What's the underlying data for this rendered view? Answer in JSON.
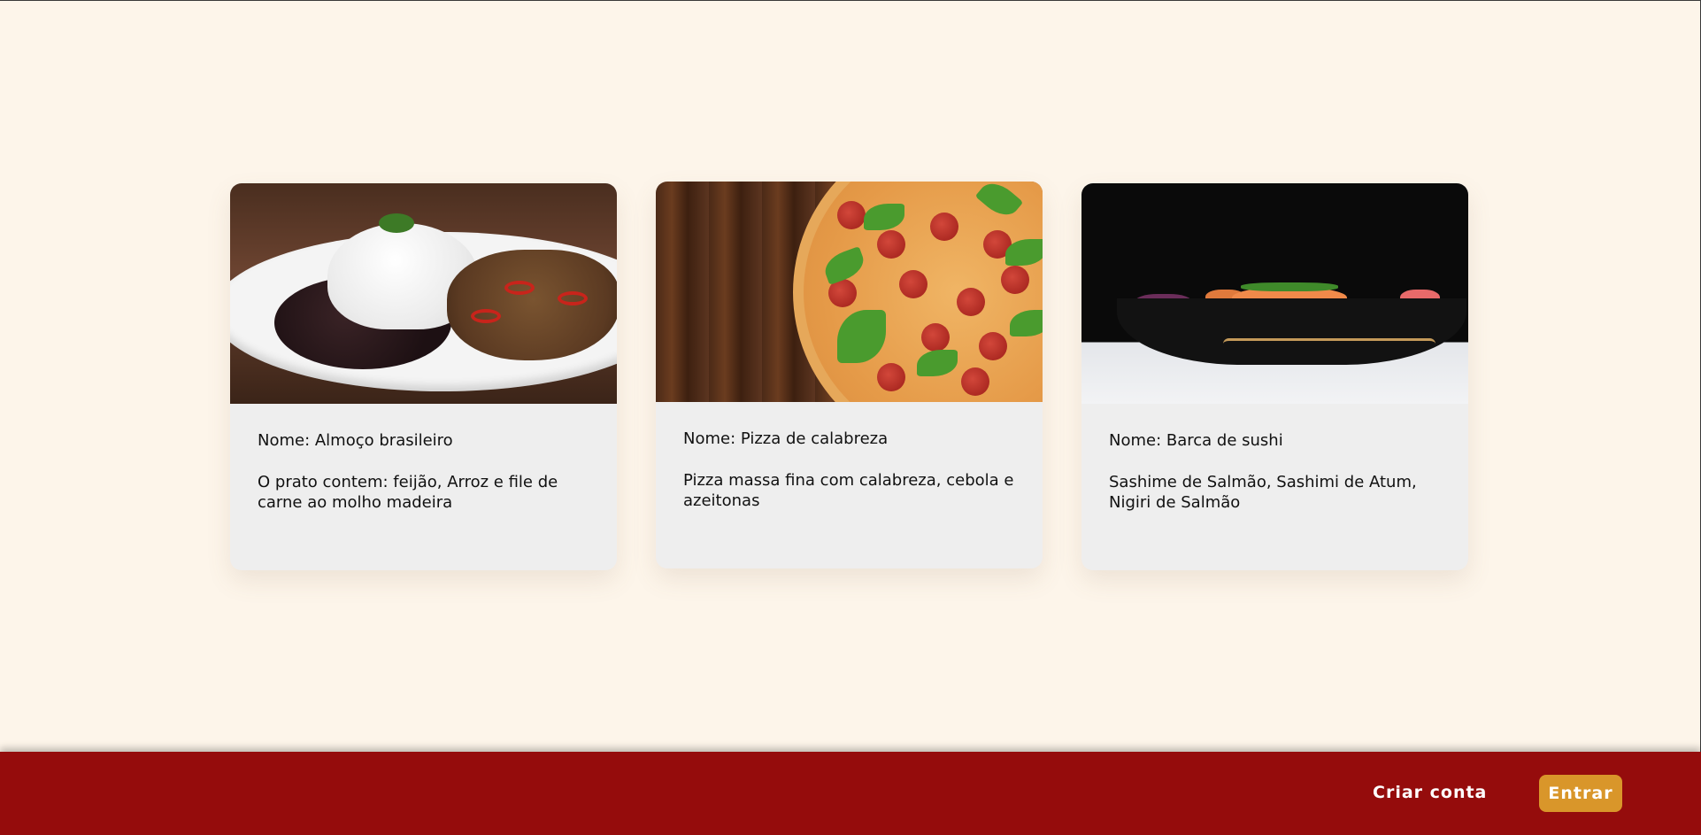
{
  "cards": [
    {
      "image": "brazilian-lunch-plate",
      "name": "Nome: Almoço brasileiro",
      "description": "O prato contem: feijão, Arroz e file de carne ao molho madeira"
    },
    {
      "image": "pepperoni-pizza",
      "name": "Nome: Pizza de calabreza",
      "description": "Pizza massa fina com calabreza, cebola e azeitonas"
    },
    {
      "image": "sushi-boat",
      "name": "Nome: Barca de sushi",
      "description": "Sashime de Salmão, Sashimi de Atum, Nigiri de Salmão"
    }
  ],
  "footer": {
    "create_account_label": "Criar conta",
    "login_label": "Entrar"
  },
  "colors": {
    "background": "#fdf5ea",
    "card": "#eeeeee",
    "footer": "#950c0c",
    "login_button": "#d9962a",
    "text": "#111111"
  }
}
